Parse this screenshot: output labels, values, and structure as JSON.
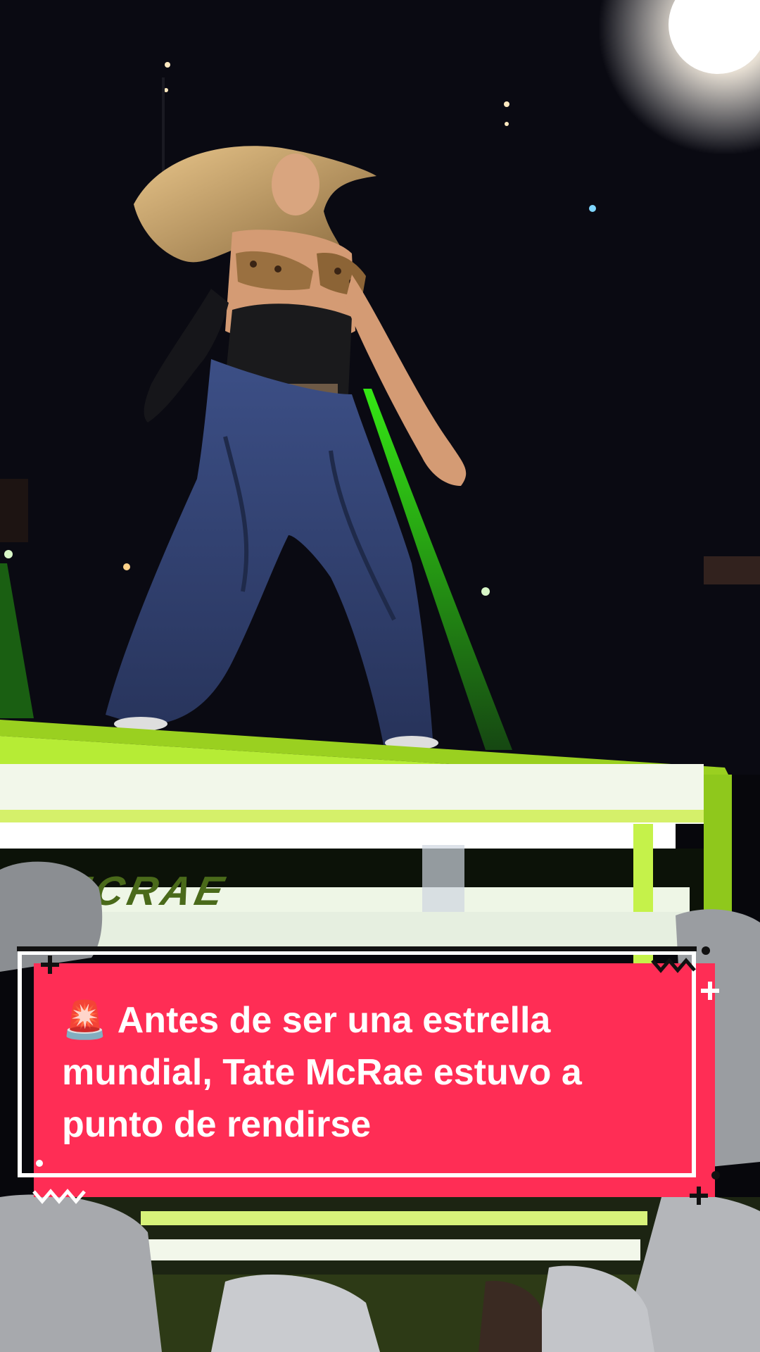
{
  "video": {
    "stage_banner_text": "TATE MCRAE"
  },
  "caption": {
    "emoji": "🚨",
    "text": "Antes de ser una estrella mundial, Tate McRae estuvo a punto de rendirse"
  },
  "colors": {
    "caption_background": "#ff2d55",
    "caption_text": "#ffffff",
    "caption_outline": "#ffffff",
    "laser": "#39ff14",
    "stage_trim": "#9ad020"
  },
  "decorations": [
    "plus-icon",
    "zigzag-icon",
    "dot-icon"
  ]
}
